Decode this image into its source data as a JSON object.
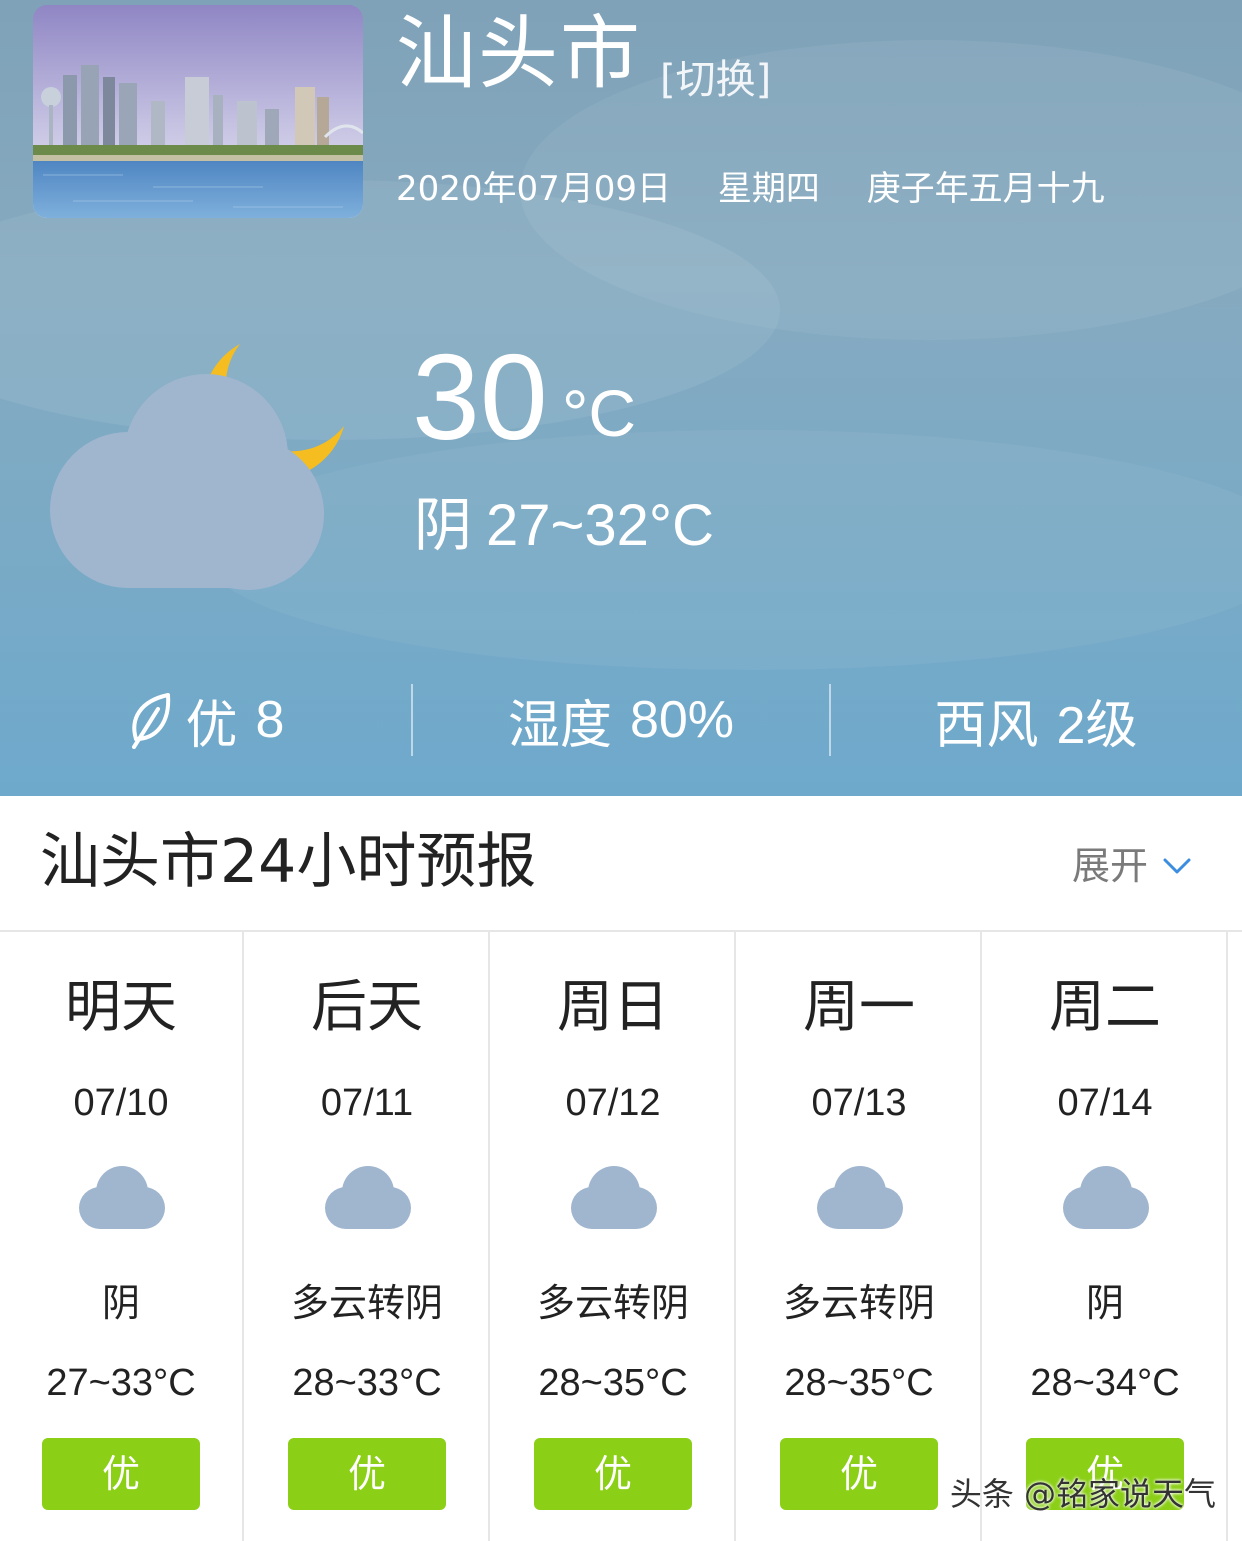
{
  "location": {
    "city": "汕头市",
    "switch_label": "[切换]",
    "date": "2020年07月09日",
    "weekday": "星期四",
    "lunar_date": "庚子年五月十九"
  },
  "current": {
    "temperature": "30",
    "unit": "°C",
    "condition": "阴",
    "range": "27~32°C",
    "icon": "cloudy-night-icon"
  },
  "stats": {
    "aqi_label": "优",
    "aqi_value": "8",
    "humidity_label": "湿度",
    "humidity_value": "80%",
    "wind_direction": "西风",
    "wind_level": "2级"
  },
  "forecast_24h": {
    "title": "汕头市24小时预报",
    "expand_label": "展开"
  },
  "daily": [
    {
      "day": "明天",
      "date": "07/10",
      "condition": "阴",
      "temp": "27~33°C",
      "aqi": "优",
      "icon": "cloud-icon"
    },
    {
      "day": "后天",
      "date": "07/11",
      "condition": "多云转阴",
      "temp": "28~33°C",
      "aqi": "优",
      "icon": "cloud-icon"
    },
    {
      "day": "周日",
      "date": "07/12",
      "condition": "多云转阴",
      "temp": "28~35°C",
      "aqi": "优",
      "icon": "cloud-icon"
    },
    {
      "day": "周一",
      "date": "07/13",
      "condition": "多云转阴",
      "temp": "28~35°C",
      "aqi": "优",
      "icon": "cloud-icon"
    },
    {
      "day": "周二",
      "date": "07/14",
      "condition": "阴",
      "temp": "28~34°C",
      "aqi": "优",
      "icon": "cloud-icon"
    }
  ],
  "watermark": "头条 @铭家说天气",
  "colors": {
    "aqi_good": "#8ccf17",
    "cloud": "#a0b6cf",
    "moon": "#f5bd1f",
    "hero_sky": "#7fa8c2"
  }
}
